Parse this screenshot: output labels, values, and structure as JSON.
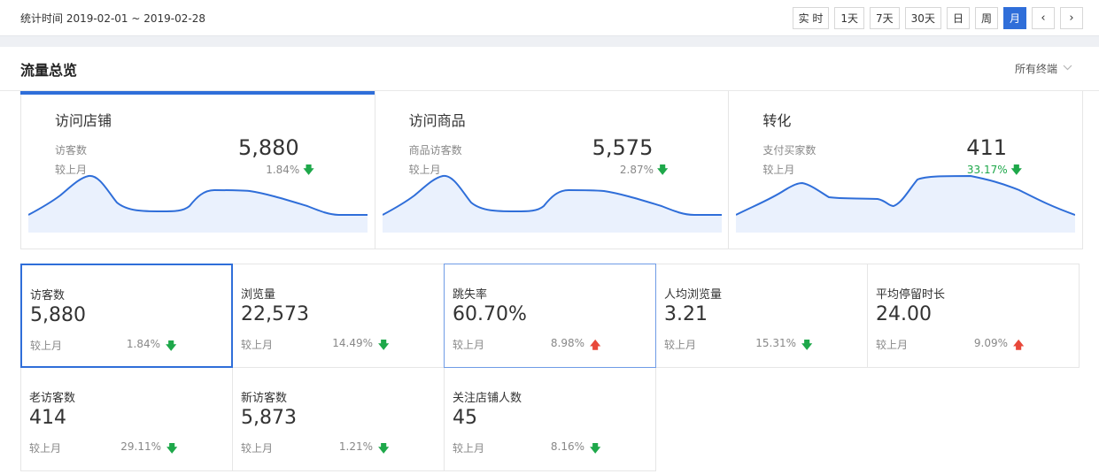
{
  "header": {
    "period": "统计时间 2019-02-01 ~ 2019-02-28",
    "buttons": [
      "实 时",
      "1天",
      "7天",
      "30天",
      "日",
      "周",
      "月"
    ],
    "active": "月",
    "prev": "‹",
    "next": "›"
  },
  "section": {
    "title": "流量总览",
    "terminal": "所有终端",
    "terminal_icon": "chevron-down-icon"
  },
  "overview": [
    {
      "title": "访问店铺",
      "metric": "访客数",
      "value": "5,880",
      "compare_label": "较上月",
      "pct": "1.84%",
      "dir": "down",
      "pct_color": "#888888"
    },
    {
      "title": "访问商品",
      "metric": "商品访客数",
      "value": "5,575",
      "compare_label": "较上月",
      "pct": "2.87%",
      "dir": "down",
      "pct_color": "#888888"
    },
    {
      "title": "转化",
      "metric": "支付买家数",
      "value": "411",
      "compare_label": "较上月",
      "pct": "33.17%",
      "dir": "down",
      "pct_color": "#1ea84a"
    }
  ],
  "metrics_row1": [
    {
      "label": "访客数",
      "value": "5,880",
      "compare": "较上月",
      "pct": "1.84%",
      "dir": "down"
    },
    {
      "label": "浏览量",
      "value": "22,573",
      "compare": "较上月",
      "pct": "14.49%",
      "dir": "down"
    },
    {
      "label": "跳失率",
      "value": "60.70%",
      "compare": "较上月",
      "pct": "8.98%",
      "dir": "up"
    },
    {
      "label": "人均浏览量",
      "value": "3.21",
      "compare": "较上月",
      "pct": "15.31%",
      "dir": "down"
    },
    {
      "label": "平均停留时长",
      "value": "24.00",
      "compare": "较上月",
      "pct": "9.09%",
      "dir": "up"
    }
  ],
  "metrics_row2": [
    {
      "label": "老访客数",
      "value": "414",
      "compare": "较上月",
      "pct": "29.11%",
      "dir": "down"
    },
    {
      "label": "新访客数",
      "value": "5,873",
      "compare": "较上月",
      "pct": "1.21%",
      "dir": "down"
    },
    {
      "label": "关注店铺人数",
      "value": "45",
      "compare": "较上月",
      "pct": "8.16%",
      "dir": "down"
    }
  ],
  "colors": {
    "accent": "#2f6ed9",
    "down": "#1ea84a",
    "up": "#e8483a",
    "area": "#eaf1fd"
  }
}
